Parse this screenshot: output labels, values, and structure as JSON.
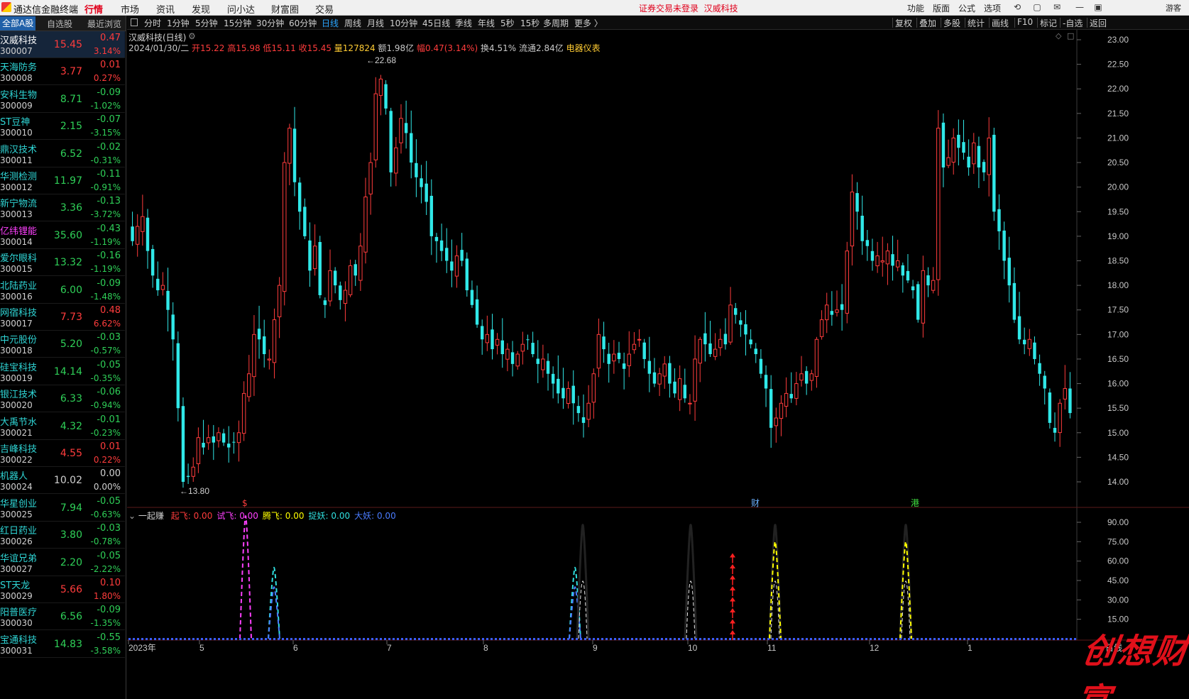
{
  "app": {
    "title": "通达信金融终端",
    "menus": [
      "行情",
      "市场",
      "资讯",
      "发现",
      "问小达",
      "财富圈",
      "交易"
    ],
    "active_menu": "行情",
    "notice": "证券交易未登录",
    "notice_stock": "汉威科技",
    "right_menus": [
      "功能",
      "版面",
      "公式",
      "选项"
    ],
    "guest": "游客"
  },
  "sidebar": {
    "tabs": [
      "全部A股",
      "自选股",
      "最近浏览"
    ],
    "stocks": [
      {
        "name": "汉威科技",
        "code": "300007",
        "price": "15.45",
        "chg": "0.47",
        "pct": "3.14%",
        "dir": "up"
      },
      {
        "name": "天海防务",
        "code": "300008",
        "price": "3.77",
        "chg": "0.01",
        "pct": "0.27%",
        "dir": "up"
      },
      {
        "name": "安科生物",
        "code": "300009",
        "price": "8.71",
        "chg": "-0.09",
        "pct": "-1.02%",
        "dir": "down"
      },
      {
        "name": "ST豆神",
        "code": "300010",
        "price": "2.15",
        "chg": "-0.07",
        "pct": "-3.15%",
        "dir": "down"
      },
      {
        "name": "鼎汉技术",
        "code": "300011",
        "price": "6.52",
        "chg": "-0.02",
        "pct": "-0.31%",
        "dir": "down"
      },
      {
        "name": "华测检测",
        "code": "300012",
        "price": "11.97",
        "chg": "-0.11",
        "pct": "-0.91%",
        "dir": "down"
      },
      {
        "name": "新宁物流",
        "code": "300013",
        "price": "3.36",
        "chg": "-0.13",
        "pct": "-3.72%",
        "dir": "down"
      },
      {
        "name": "亿纬锂能",
        "code": "300014",
        "price": "35.60",
        "chg": "-0.43",
        "pct": "-1.19%",
        "dir": "down",
        "magenta": true
      },
      {
        "name": "爱尔眼科",
        "code": "300015",
        "price": "13.32",
        "chg": "-0.16",
        "pct": "-1.19%",
        "dir": "down"
      },
      {
        "name": "北陆药业",
        "code": "300016",
        "price": "6.00",
        "chg": "-0.09",
        "pct": "-1.48%",
        "dir": "down"
      },
      {
        "name": "网宿科技",
        "code": "300017",
        "price": "7.73",
        "chg": "0.48",
        "pct": "6.62%",
        "dir": "up"
      },
      {
        "name": "中元股份",
        "code": "300018",
        "price": "5.20",
        "chg": "-0.03",
        "pct": "-0.57%",
        "dir": "down"
      },
      {
        "name": "硅宝科技",
        "code": "300019",
        "price": "14.14",
        "chg": "-0.05",
        "pct": "-0.35%",
        "dir": "down"
      },
      {
        "name": "银江技术",
        "code": "300020",
        "price": "6.33",
        "chg": "-0.06",
        "pct": "-0.94%",
        "dir": "down"
      },
      {
        "name": "大禹节水",
        "code": "300021",
        "price": "4.32",
        "chg": "-0.01",
        "pct": "-0.23%",
        "dir": "down"
      },
      {
        "name": "吉峰科技",
        "code": "300022",
        "price": "4.55",
        "chg": "0.01",
        "pct": "0.22%",
        "dir": "up"
      },
      {
        "name": "机器人",
        "code": "300024",
        "price": "10.02",
        "chg": "0.00",
        "pct": "0.00%",
        "dir": "flat"
      },
      {
        "name": "华星创业",
        "code": "300025",
        "price": "7.94",
        "chg": "-0.05",
        "pct": "-0.63%",
        "dir": "down"
      },
      {
        "name": "红日药业",
        "code": "300026",
        "price": "3.80",
        "chg": "-0.03",
        "pct": "-0.78%",
        "dir": "down"
      },
      {
        "name": "华谊兄弟",
        "code": "300027",
        "price": "2.20",
        "chg": "-0.05",
        "pct": "-2.22%",
        "dir": "down"
      },
      {
        "name": "ST天龙",
        "code": "300029",
        "price": "5.66",
        "chg": "0.10",
        "pct": "1.80%",
        "dir": "up"
      },
      {
        "name": "阳普医疗",
        "code": "300030",
        "price": "6.56",
        "chg": "-0.09",
        "pct": "-1.35%",
        "dir": "down"
      },
      {
        "name": "宝通科技",
        "code": "300031",
        "price": "14.83",
        "chg": "-0.55",
        "pct": "-3.58%",
        "dir": "down"
      }
    ]
  },
  "periods": [
    "分时",
    "1分钟",
    "5分钟",
    "15分钟",
    "30分钟",
    "60分钟",
    "日线",
    "周线",
    "月线",
    "10分钟",
    "45日线",
    "季线",
    "年线",
    "5秒",
    "15秒",
    "多周期",
    "更多 〉"
  ],
  "active_period": "日线",
  "tools": [
    "复权",
    "叠加",
    "多股",
    "统计",
    "画线",
    "F10",
    "标记",
    "-自选",
    "返回"
  ],
  "chart_header": {
    "title": "汉威科技(日线)",
    "date": "2024/01/30/二",
    "open": "开15.22",
    "high": "高15.98",
    "low": "低15.11",
    "close": "收15.45",
    "volume": "量127824",
    "amount": "额1.98亿",
    "range": "幅0.47(3.14%)",
    "turnover": "换4.51%",
    "float": "流通2.84亿",
    "sector": "电器仪表"
  },
  "indicator_header": {
    "name": "一起赚",
    "items": [
      {
        "label": "起飞:",
        "value": "0.00",
        "color": "#ff3c3c"
      },
      {
        "label": "试飞:",
        "value": "0.00",
        "color": "#ff40ff"
      },
      {
        "label": "腾飞:",
        "value": "0.00",
        "color": "#ffff00"
      },
      {
        "label": "捉妖:",
        "value": "0.00",
        "color": "#30e0e0"
      },
      {
        "label": "大妖:",
        "value": "0.00",
        "color": "#4a7cff"
      }
    ]
  },
  "chart_data": {
    "type": "candlestick",
    "price_axis": {
      "min": 14.0,
      "max": 23.0,
      "ticks": [
        "23.00",
        "22.50",
        "22.00",
        "21.50",
        "21.00",
        "20.50",
        "20.00",
        "19.50",
        "19.00",
        "18.50",
        "18.00",
        "17.50",
        "17.00",
        "16.50",
        "16.00",
        "15.50",
        "15.00",
        "14.50",
        "14.00"
      ]
    },
    "indicator_axis": {
      "min": 0,
      "max": 90,
      "ticks": [
        "90.00",
        "75.00",
        "60.00",
        "45.00",
        "30.00",
        "15.00"
      ]
    },
    "x_labels": [
      "2023年",
      "5",
      "6",
      "7",
      "8",
      "9",
      "10",
      "11",
      "12",
      "1"
    ],
    "bottom_right_label": "日线",
    "annotations": {
      "high": "22.68",
      "low": "13.80"
    },
    "markers": [
      "$",
      "财",
      "港"
    ],
    "closes": [
      18.9,
      19.2,
      19.4,
      18.7,
      18.2,
      17.9,
      18.0,
      17.5,
      16.9,
      15.5,
      14.0,
      14.1,
      14.3,
      14.9,
      14.7,
      14.9,
      14.8,
      15.0,
      14.8,
      14.7,
      14.8,
      15.0,
      15.8,
      16.2,
      17.0,
      16.9,
      16.6,
      16.5,
      17.3,
      18.0,
      20.5,
      21.2,
      20.1,
      19.5,
      19.0,
      18.3,
      18.8,
      17.8,
      17.6,
      18.3,
      18.0,
      17.7,
      17.9,
      18.4,
      18.2,
      18.8,
      19.8,
      20.5,
      21.9,
      22.2,
      21.6,
      20.3,
      20.8,
      21.4,
      21.1,
      20.5,
      20.2,
      20.0,
      19.7,
      19.0,
      18.9,
      18.7,
      18.5,
      18.3,
      18.6,
      18.5,
      17.9,
      17.6,
      17.2,
      16.9,
      17.0,
      16.7,
      16.9,
      16.6,
      16.7,
      16.4,
      16.6,
      16.8,
      16.9,
      16.6,
      16.4,
      16.5,
      16.2,
      16.0,
      15.8,
      15.7,
      15.9,
      15.6,
      15.4,
      15.2,
      15.6,
      16.2,
      17.0,
      16.7,
      16.4,
      16.6,
      16.5,
      16.3,
      16.6,
      16.8,
      16.9,
      16.5,
      16.2,
      16.0,
      16.2,
      16.4,
      16.0,
      15.8,
      16.1,
      15.7,
      15.6,
      16.5,
      16.9,
      16.8,
      16.6,
      16.7,
      16.9,
      16.8,
      17.6,
      17.4,
      17.2,
      17.0,
      16.8,
      16.6,
      16.2,
      15.9,
      15.1,
      15.3,
      15.6,
      15.8,
      15.7,
      16.0,
      16.2,
      16.0,
      16.2,
      16.9,
      17.3,
      17.6,
      17.4,
      17.5,
      17.5,
      18.7,
      19.9,
      19.5,
      18.9,
      18.8,
      18.5,
      18.6,
      18.5,
      18.7,
      18.4,
      18.5,
      18.2,
      18.1,
      17.9,
      17.3,
      18.3,
      18.0,
      18.1,
      21.2,
      20.4,
      20.6,
      21.0,
      20.8,
      20.7,
      20.4,
      20.9,
      20.4,
      20.3,
      21.0,
      19.5,
      19.1,
      18.5,
      18.0,
      17.3,
      16.9,
      16.8,
      16.9,
      16.5,
      16.2,
      15.9,
      15.2,
      15.0,
      15.6,
      15.9,
      15.4
    ]
  }
}
